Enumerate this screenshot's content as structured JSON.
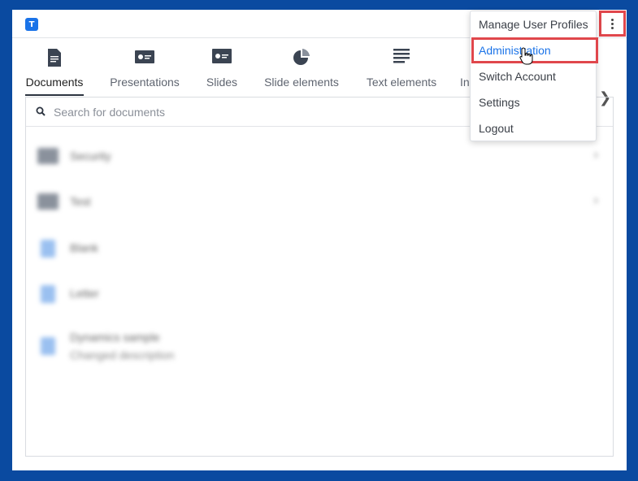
{
  "app": {
    "logo_letter": "T"
  },
  "tabs": [
    {
      "label": "Documents",
      "icon": "document-icon",
      "active": true
    },
    {
      "label": "Presentations",
      "icon": "presentation-icon",
      "active": false
    },
    {
      "label": "Slides",
      "icon": "slide-icon",
      "active": false
    },
    {
      "label": "Slide elements",
      "icon": "pie-chart-icon",
      "active": false
    },
    {
      "label": "Text elements",
      "icon": "text-lines-icon",
      "active": false
    },
    {
      "label": "In",
      "icon": "",
      "active": false
    }
  ],
  "search": {
    "placeholder": "Search for documents",
    "value": ""
  },
  "list": [
    {
      "name": "Security",
      "type": "folder"
    },
    {
      "name": "Test",
      "type": "folder"
    },
    {
      "name": "Blank",
      "type": "document"
    },
    {
      "name": "Letter",
      "type": "document"
    },
    {
      "name": "Dynamics sample",
      "subtitle": "Changed description",
      "type": "document"
    }
  ],
  "menu": {
    "items": [
      {
        "label": "Manage User Profiles"
      },
      {
        "label": "Administration"
      },
      {
        "label": "Switch Account"
      },
      {
        "label": "Settings"
      },
      {
        "label": "Logout"
      }
    ]
  },
  "colors": {
    "accent": "#1a73e8",
    "frame": "#0a4aa0",
    "highlight": "#e0474c"
  }
}
